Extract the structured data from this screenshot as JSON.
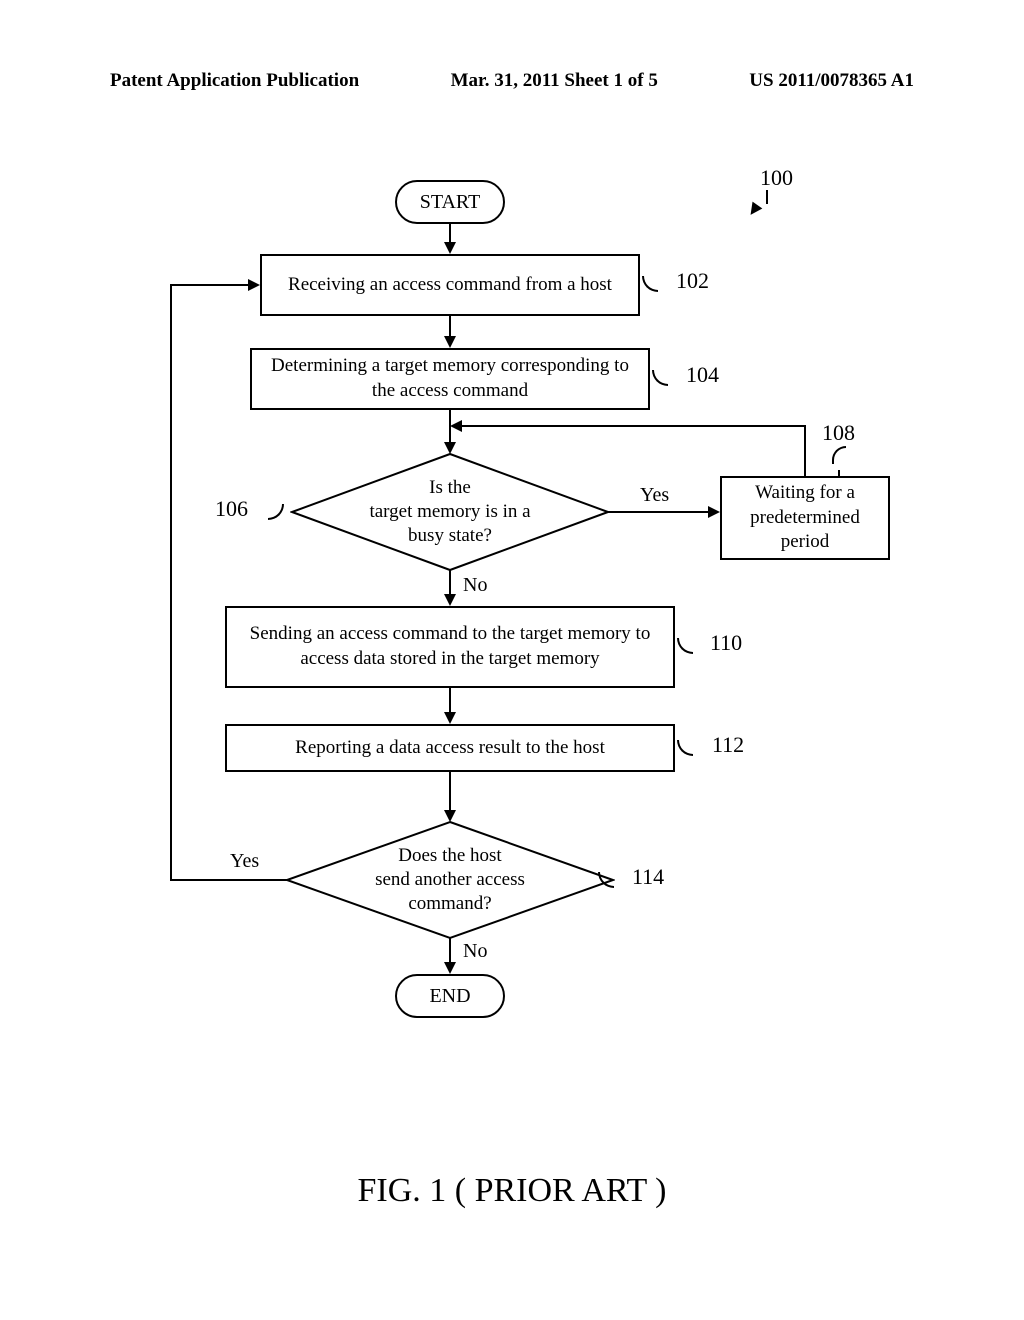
{
  "header": {
    "left": "Patent Application Publication",
    "center": "Mar. 31, 2011  Sheet 1 of 5",
    "right": "US 2011/0078365 A1"
  },
  "nodes": {
    "start": "START",
    "end": "END",
    "step102": "Receiving an access command from a host",
    "step104": "Determining a target memory corresponding to the access command",
    "dec106": "Is the\ntarget memory is in a\nbusy state?",
    "step108": "Waiting for a predetermined period",
    "step110": "Sending an access command to the target memory to access data stored in the target memory",
    "step112": "Reporting a data access result to the host",
    "dec114": "Does the host\nsend another access\ncommand?"
  },
  "labels": {
    "ref100": "100",
    "ref102": "102",
    "ref104": "104",
    "ref106": "106",
    "ref108": "108",
    "ref110": "110",
    "ref112": "112",
    "ref114": "114",
    "yes": "Yes",
    "no": "No"
  },
  "caption": "FIG. 1  ( PRIOR ART )"
}
